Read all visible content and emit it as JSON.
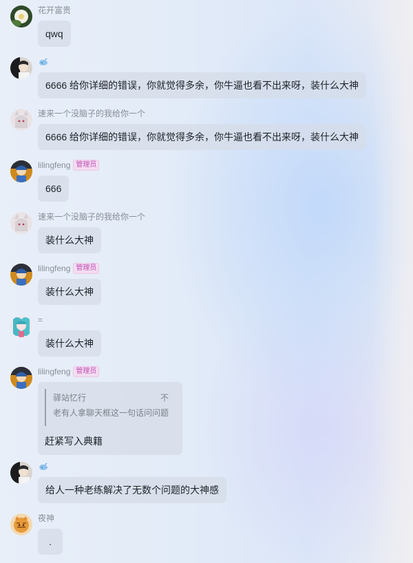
{
  "chat": {
    "messages": [
      {
        "sender": "花开富贵",
        "badge": "",
        "text": "qwq"
      },
      {
        "sender": "",
        "badge": "",
        "text": "6666 给你详细的错误，你就觉得多余，你牛逼也看不出来呀，装什么大神"
      },
      {
        "sender": "速来一个没脑子的我给你一个",
        "badge": "",
        "text": "6666 给你详细的错误，你就觉得多余，你牛逼也看不出来呀，装什么大神"
      },
      {
        "sender": "lilingfeng",
        "badge": "管理员",
        "text": "666"
      },
      {
        "sender": "速来一个没脑子的我给你一个",
        "badge": "",
        "text": "装什么大神"
      },
      {
        "sender": "lilingfeng",
        "badge": "管理员",
        "text": "装什么大神"
      },
      {
        "sender": "=",
        "badge": "",
        "text": "装什么大神"
      },
      {
        "sender": "lilingfeng",
        "badge": "管理员",
        "quote_author": "驿站忆行",
        "quote_right": "不",
        "quote_text": "老有人拿聊天框这一句话问问题",
        "text": "赶紧写入典籍"
      },
      {
        "sender": "",
        "badge": "",
        "text": "给人一种老练解决了无数个问题的大神感"
      },
      {
        "sender": "夜神",
        "badge": "",
        "text": "."
      }
    ]
  }
}
